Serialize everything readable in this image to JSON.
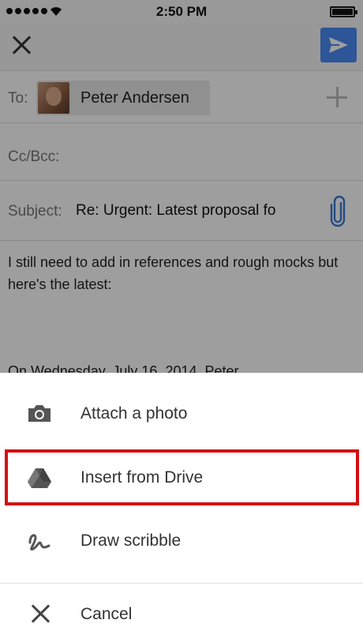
{
  "status": {
    "time": "2:50 PM"
  },
  "compose": {
    "to_label": "To:",
    "recipient": "Peter Andersen",
    "cc_label": "Cc/Bcc:",
    "subject_label": "Subject:",
    "subject_value": "Re: Urgent: Latest proposal fo",
    "body": "I still need to add in references and rough mocks but here's the latest:",
    "quote": "On Wednesday, July 16, 2014, Peter"
  },
  "sheet": {
    "items": [
      {
        "icon": "camera-icon",
        "label": "Attach a photo"
      },
      {
        "icon": "drive-icon",
        "label": "Insert from Drive"
      },
      {
        "icon": "scribble-icon",
        "label": "Draw scribble"
      },
      {
        "icon": "close-icon",
        "label": "Cancel"
      }
    ]
  },
  "colors": {
    "send_button": "#4a8af4",
    "highlight_border": "#d40f14"
  }
}
